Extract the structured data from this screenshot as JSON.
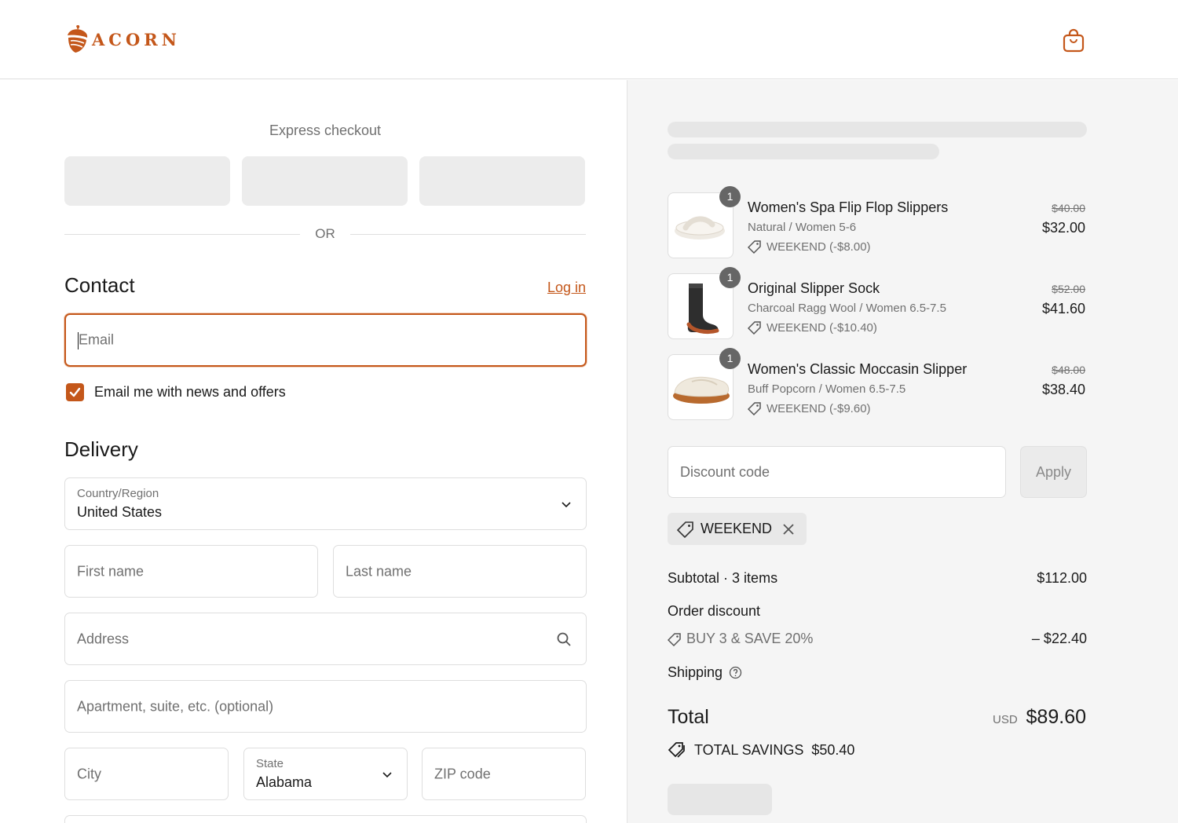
{
  "header": {
    "brand": "ACORN",
    "cart_icon": "shopping-bag-icon"
  },
  "express": {
    "title": "Express checkout",
    "or": "OR"
  },
  "contact": {
    "title": "Contact",
    "login": "Log in",
    "email_placeholder": "Email",
    "newsletter_label": "Email me with news and offers",
    "newsletter_checked": true
  },
  "delivery": {
    "title": "Delivery",
    "country_label": "Country/Region",
    "country_value": "United States",
    "first_name_placeholder": "First name",
    "last_name_placeholder": "Last name",
    "address_placeholder": "Address",
    "apartment_placeholder": "Apartment, suite, etc. (optional)",
    "city_placeholder": "City",
    "state_label": "State",
    "state_value": "Alabama",
    "zip_placeholder": "ZIP code"
  },
  "order": {
    "items": [
      {
        "qty": "1",
        "name": "Women's Spa Flip Flop Slippers",
        "variant": "Natural / Women 5-6",
        "discount": "WEEKEND (-$8.00)",
        "original_price": "$40.00",
        "price": "$32.00"
      },
      {
        "qty": "1",
        "name": "Original Slipper Sock",
        "variant": "Charcoal Ragg Wool / Women 6.5-7.5",
        "discount": "WEEKEND (-$10.40)",
        "original_price": "$52.00",
        "price": "$41.60"
      },
      {
        "qty": "1",
        "name": "Women's Classic Moccasin Slipper",
        "variant": "Buff Popcorn / Women 6.5-7.5",
        "discount": "WEEKEND (-$9.60)",
        "original_price": "$48.00",
        "price": "$38.40"
      }
    ],
    "discount_placeholder": "Discount code",
    "apply_label": "Apply",
    "applied_code": "WEEKEND",
    "subtotal_label": "Subtotal · 3 items",
    "subtotal_value": "$112.00",
    "order_discount_label": "Order discount",
    "order_discount_name": "BUY 3 & SAVE 20%",
    "order_discount_value": "– $22.40",
    "shipping_label": "Shipping",
    "total_label": "Total",
    "currency": "USD",
    "total_value": "$89.60",
    "savings_label": "TOTAL SAVINGS",
    "savings_value": "$50.40"
  },
  "colors": {
    "accent": "#c4571a",
    "panel_bg": "#f5f5f5"
  }
}
